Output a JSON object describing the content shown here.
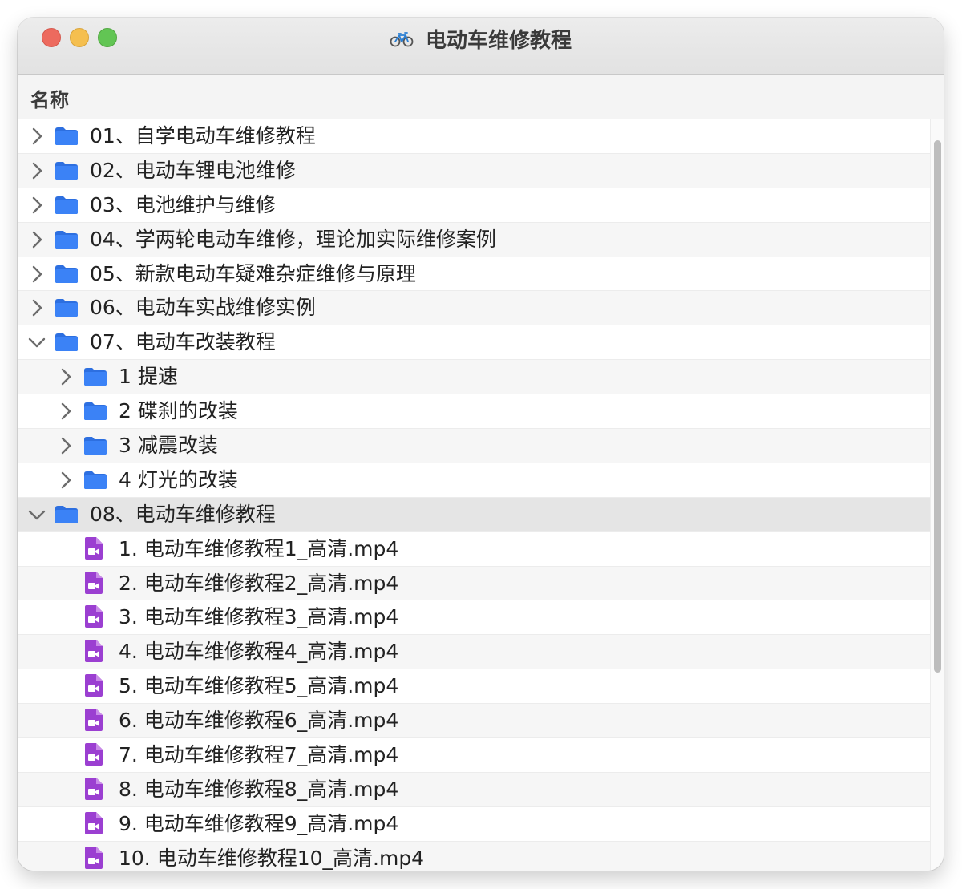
{
  "window": {
    "title": "电动车维修教程",
    "title_icon": "bicycle-icon"
  },
  "header": {
    "column_name": "名称"
  },
  "colors": {
    "folder": "#3b82f6",
    "video_file": "#9b3fd1",
    "selected_row": "#e5e5e5"
  },
  "rows": [
    {
      "label": "01、自学电动车维修教程",
      "kind": "folder",
      "level": 0,
      "state": "collapsed"
    },
    {
      "label": "02、电动车锂电池维修",
      "kind": "folder",
      "level": 0,
      "state": "collapsed"
    },
    {
      "label": "03、电池维护与维修",
      "kind": "folder",
      "level": 0,
      "state": "collapsed"
    },
    {
      "label": "04、学两轮电动车维修，理论加实际维修案例",
      "kind": "folder",
      "level": 0,
      "state": "collapsed"
    },
    {
      "label": "05、新款电动车疑难杂症维修与原理",
      "kind": "folder",
      "level": 0,
      "state": "collapsed"
    },
    {
      "label": "06、电动车实战维修实例",
      "kind": "folder",
      "level": 0,
      "state": "collapsed"
    },
    {
      "label": "07、电动车改装教程",
      "kind": "folder",
      "level": 0,
      "state": "expanded"
    },
    {
      "label": "1 提速",
      "kind": "folder",
      "level": 1,
      "state": "collapsed"
    },
    {
      "label": "2 碟刹的改装",
      "kind": "folder",
      "level": 1,
      "state": "collapsed"
    },
    {
      "label": "3 减震改装",
      "kind": "folder",
      "level": 1,
      "state": "collapsed"
    },
    {
      "label": "4 灯光的改装",
      "kind": "folder",
      "level": 1,
      "state": "collapsed"
    },
    {
      "label": "08、电动车维修教程",
      "kind": "folder",
      "level": 0,
      "state": "expanded",
      "selected": true
    },
    {
      "label": "1. 电动车维修教程1_高清.mp4",
      "kind": "video",
      "level": 1
    },
    {
      "label": "2. 电动车维修教程2_高清.mp4",
      "kind": "video",
      "level": 1
    },
    {
      "label": "3. 电动车维修教程3_高清.mp4",
      "kind": "video",
      "level": 1
    },
    {
      "label": "4. 电动车维修教程4_高清.mp4",
      "kind": "video",
      "level": 1
    },
    {
      "label": "5. 电动车维修教程5_高清.mp4",
      "kind": "video",
      "level": 1
    },
    {
      "label": "6. 电动车维修教程6_高清.mp4",
      "kind": "video",
      "level": 1
    },
    {
      "label": "7. 电动车维修教程7_高清.mp4",
      "kind": "video",
      "level": 1
    },
    {
      "label": "8. 电动车维修教程8_高清.mp4",
      "kind": "video",
      "level": 1
    },
    {
      "label": "9. 电动车维修教程9_高清.mp4",
      "kind": "video",
      "level": 1
    },
    {
      "label": "10. 电动车维修教程10_高清.mp4",
      "kind": "video",
      "level": 1
    }
  ]
}
